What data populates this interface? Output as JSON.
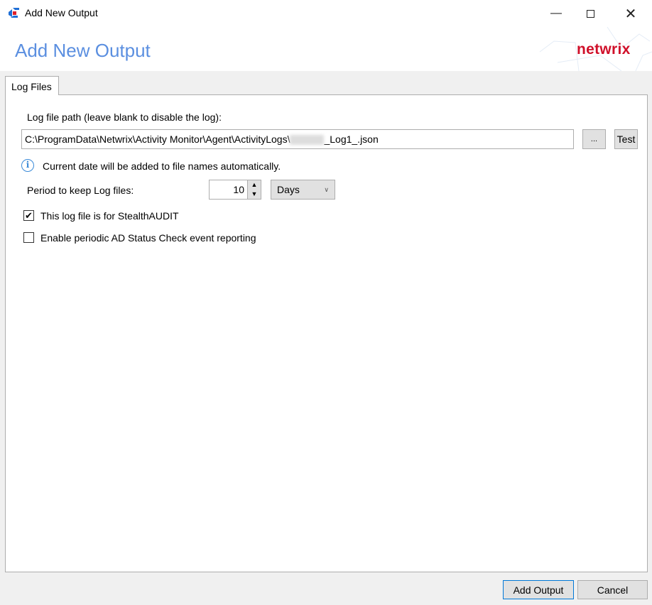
{
  "window": {
    "title": "Add New Output",
    "minimize_icon": "minimize-icon",
    "maximize_icon": "maximize-icon",
    "close_icon": "close-icon"
  },
  "header": {
    "title": "Add New Output",
    "logo": "netwrix",
    "accent": "#5b8fe0",
    "logo_color": "#d0102a"
  },
  "tabs": [
    {
      "label": "Log Files",
      "active": true
    }
  ],
  "form": {
    "path_label": "Log file path (leave blank to disable the log):",
    "path_prefix": "C:\\ProgramData\\Netwrix\\Activity Monitor\\Agent\\ActivityLogs\\",
    "path_suffix": "_Log1_.json",
    "browse_label": "...",
    "test_label": "Test",
    "info_text": "Current date will be added to file names automatically.",
    "period_label": "Period to keep Log files:",
    "period_value": "10",
    "period_unit": "Days",
    "stealthaudit_label": "This log file is for StealthAUDIT",
    "stealthaudit_checked": true,
    "ad_status_label": "Enable periodic AD Status Check event reporting",
    "ad_status_checked": false
  },
  "footer": {
    "add_label": "Add Output",
    "cancel_label": "Cancel"
  }
}
